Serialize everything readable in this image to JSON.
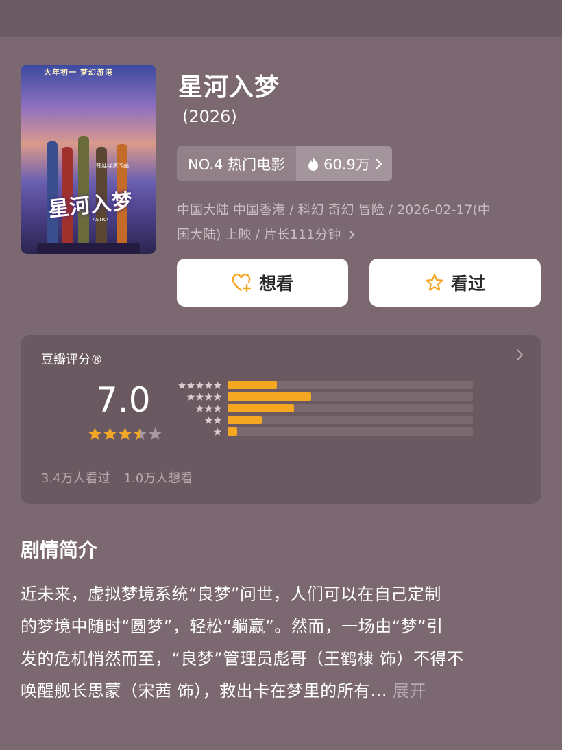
{
  "movie": {
    "title": "星河入梦",
    "year": "(2026)",
    "rank_label": "NO.4 热门电影",
    "heat_count": "60.9万",
    "meta_line1": "中国大陆 中国香港 / 科幻 奇幻 冒险 / 2026-02-17(中",
    "meta_line2": "国大陆) 上映 / 片长111分钟",
    "poster": {
      "top_text": "大年初一 梦幻游港",
      "sub_text": "韩延导演作品",
      "title_text": "星河入梦",
      "tag_text": "ASTRA"
    }
  },
  "actions": {
    "want_label": "想看",
    "seen_label": "看过"
  },
  "rating": {
    "label": "豆瓣评分®",
    "score": "7.0",
    "star_value": 3.5,
    "distribution": [
      {
        "stars": 5,
        "fraction": 0.2
      },
      {
        "stars": 4,
        "fraction": 0.34
      },
      {
        "stars": 3,
        "fraction": 0.27
      },
      {
        "stars": 2,
        "fraction": 0.14
      },
      {
        "stars": 1,
        "fraction": 0.04
      }
    ],
    "watched": "3.4万人看过",
    "wanted": "1.0万人想看"
  },
  "synopsis": {
    "title": "剧情简介",
    "lines": [
      "近未来，虚拟梦境系统“良梦”问世，人们可以在自己定制",
      "的梦境中随时“圆梦”，轻松“躺赢”。然而，一场由“梦”引",
      "发的危机悄然而至，“良梦”管理员彪哥（王鹤棣 饰）不得不",
      "唤醒舰长思蒙（宋茜 饰），救出卡在梦里的所有..."
    ],
    "expand_label": "展开"
  },
  "colors": {
    "background": "#7b6871",
    "card": "#6b5961",
    "accent_star": "#f5a623",
    "muted_text": "#cabdc3"
  },
  "icons": {
    "heat": "flame-icon",
    "want": "heart-plus-icon",
    "seen": "star-outline-icon",
    "chevron": "chevron-right-icon"
  }
}
